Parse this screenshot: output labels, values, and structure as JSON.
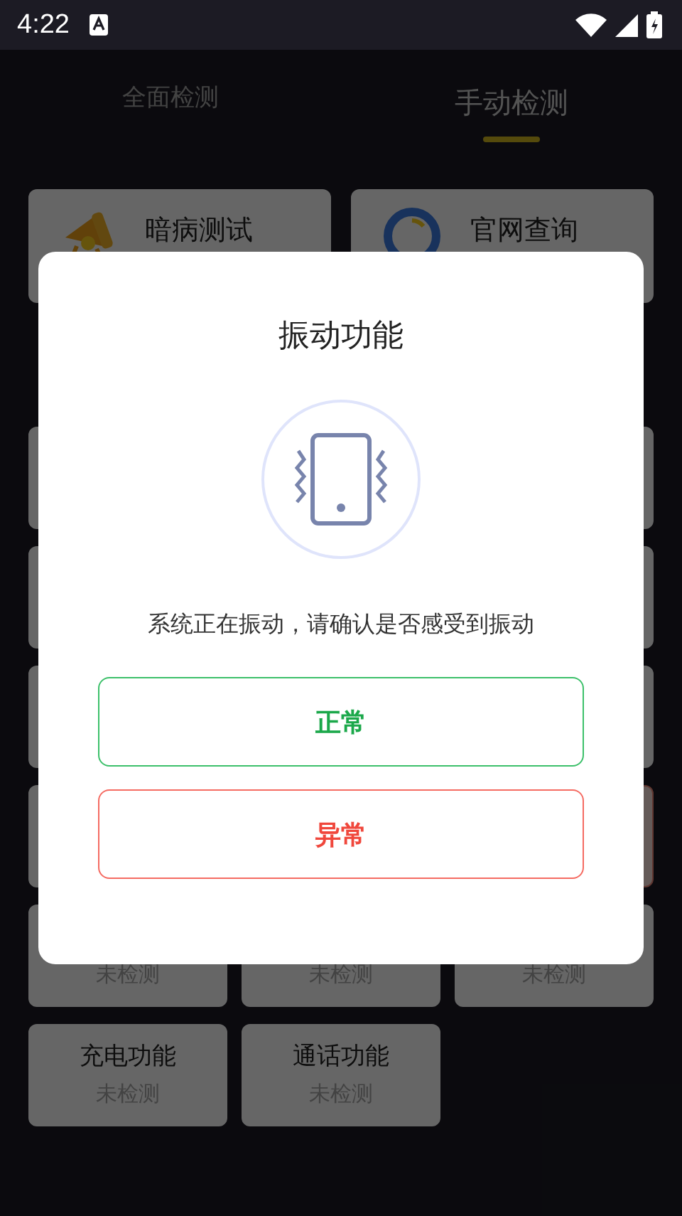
{
  "status_bar": {
    "time": "4:22"
  },
  "tabs": [
    {
      "label": "全面检测",
      "selected": false
    },
    {
      "label": "手动检测",
      "selected": true
    }
  ],
  "shortcuts": [
    {
      "label": "暗病测试",
      "kind": "megaphone"
    },
    {
      "label": "官网查询",
      "kind": "ring"
    }
  ],
  "test_rows": [
    {
      "left": {
        "abnormal": false
      },
      "right": {
        "abnormal": false
      }
    },
    {
      "left": {
        "abnormal": false
      },
      "right": {
        "abnormal": false
      }
    },
    {
      "left": {
        "abnormal": false
      },
      "right": {
        "abnormal": false
      }
    },
    {
      "left": {
        "abnormal": false
      },
      "right": {
        "abnormal": true
      }
    },
    {
      "left": {
        "status": "未检测",
        "abnormal": false
      },
      "middle": {
        "status": "未检测",
        "abnormal": false
      },
      "right": {
        "status": "未检测",
        "abnormal": false
      }
    },
    {
      "left": {
        "label": "充电功能",
        "status": "未检测",
        "abnormal": false
      },
      "middle": {
        "label": "通话功能",
        "status": "未检测",
        "abnormal": false
      }
    }
  ],
  "dialog": {
    "title": "振动功能",
    "message": "系统正在振动，请确认是否感受到振动",
    "buttons": [
      {
        "label": "正常",
        "kind": "normal"
      },
      {
        "label": "异常",
        "kind": "abnormal"
      }
    ]
  }
}
